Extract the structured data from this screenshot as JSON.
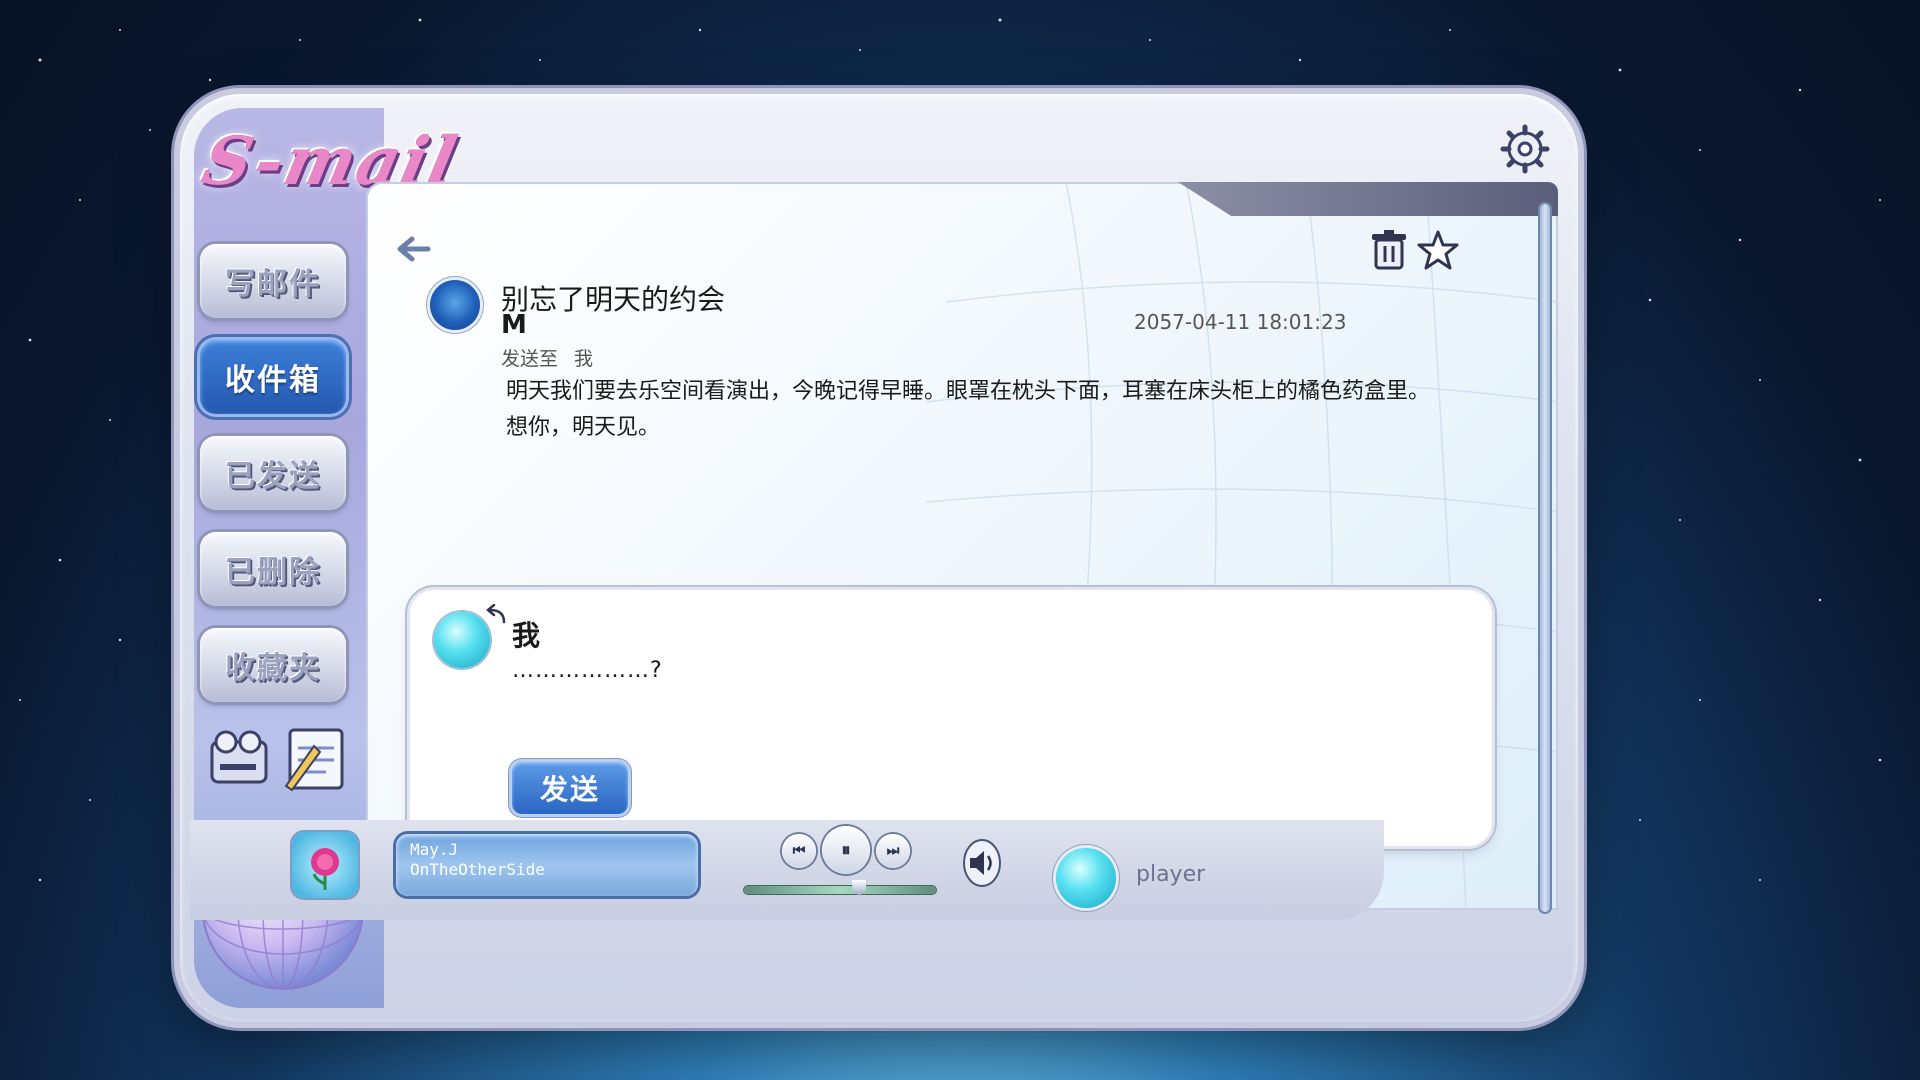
{
  "app": {
    "logo_text": "S-mail"
  },
  "sidebar": {
    "items": [
      {
        "label": "写邮件",
        "active": false
      },
      {
        "label": "收件箱",
        "active": true
      },
      {
        "label": "已发送",
        "active": false
      },
      {
        "label": "已删除",
        "active": false
      },
      {
        "label": "收藏夹",
        "active": false
      }
    ]
  },
  "email": {
    "subject": "别忘了明天的约会",
    "sender": "M",
    "timestamp": "2057-04-11 18:01:23",
    "sent_to_label": "发送至",
    "sent_to": "我",
    "body_lines": [
      "明天我们要去乐空间看演出，今晚记得早睡。眼罩在枕头下面，耳塞在床头柜上的橘色药盒里。",
      "想你，明天见。"
    ]
  },
  "reply": {
    "name": "我",
    "text": "………………?",
    "send_label": "发送"
  },
  "player": {
    "artist": "May.J",
    "track": "OnTheOtherSide",
    "user_name": "player",
    "progress": 0.6
  },
  "colors": {
    "accent": "#2a66c4",
    "active_nav": "#2559b0"
  }
}
